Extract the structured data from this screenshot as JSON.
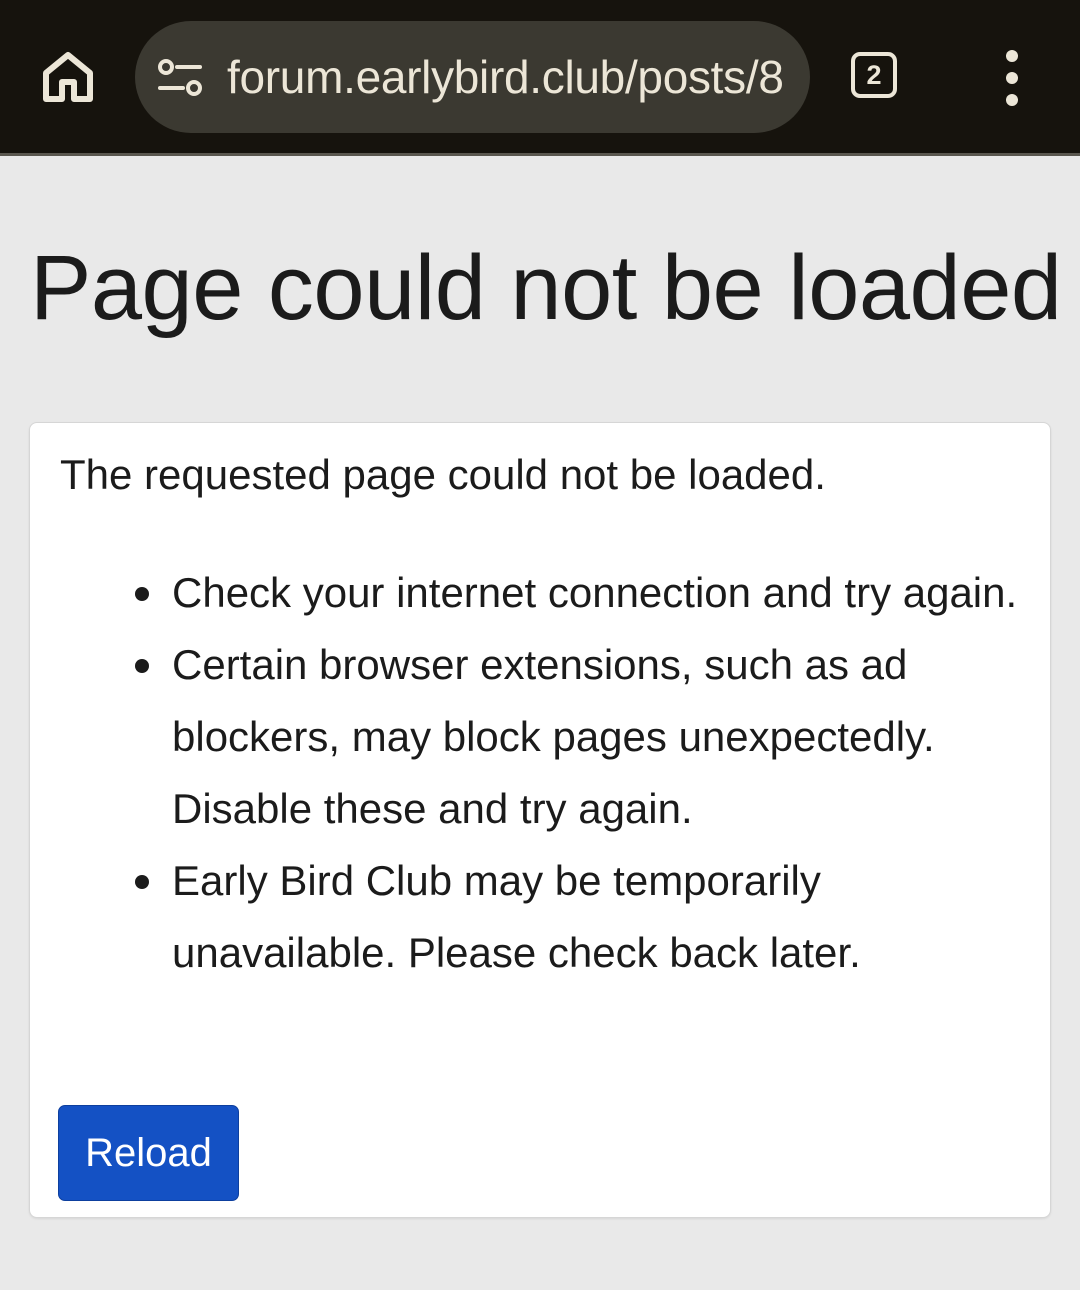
{
  "browser": {
    "url": "forum.earlybird.club/posts/8",
    "tab_count": "2",
    "icons": {
      "home": "home-icon",
      "site_info": "tune-icon",
      "menu": "more-vert-icon"
    },
    "colors": {
      "toolbar": "#16130d",
      "omnibox": "#3b3931",
      "toolbar_text": "#ece6d7"
    }
  },
  "page": {
    "title": "Page could not be loaded",
    "intro": "The requested page could not be loaded.",
    "tips": [
      "Check your internet connection and try again.",
      "Certain browser extensions, such as ad blockers, may block pages unexpectedly. Disable these and try again.",
      "Early Bird Club may be temporarily unavailable. Please check back later."
    ],
    "reload_label": "Reload",
    "colors": {
      "background": "#e9e9e9",
      "button": "#1451c4"
    }
  }
}
